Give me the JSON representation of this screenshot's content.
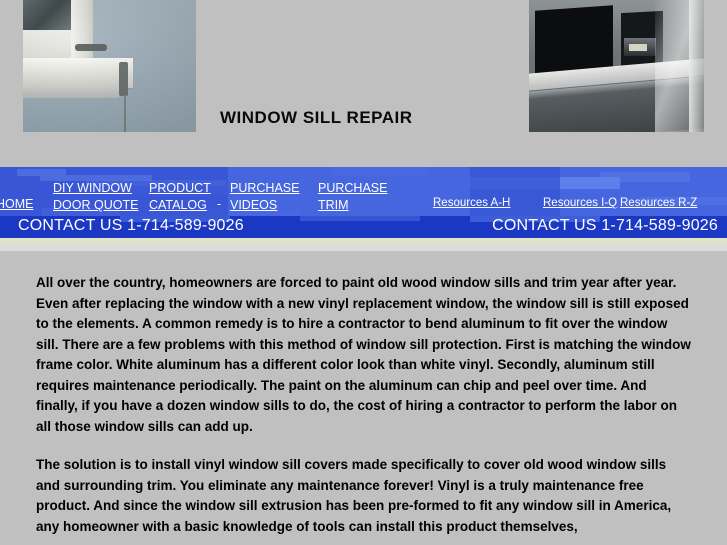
{
  "banner": {
    "title": "WINDOW SILL REPAIR",
    "left_photo_alt": "damaged white wood window sill on blue stucco wall",
    "right_photo_alt": "dark photo of house windows with sills"
  },
  "nav": {
    "items": [
      {
        "id": "home",
        "label": "HOME"
      },
      {
        "id": "diy",
        "label": "DIY WINDOW\nDOOR QUOTE"
      },
      {
        "id": "catalog",
        "label": "PRODUCT\nCATALOG"
      },
      {
        "id": "videos",
        "label": "PURCHASE\nVIDEOS"
      },
      {
        "id": "trim",
        "label": "PURCHASE\nTRIM"
      }
    ],
    "separator": "-",
    "resources": [
      {
        "id": "res-ah",
        "label": "Resources A-H"
      },
      {
        "id": "res-iq",
        "label": "Resources I-Q"
      },
      {
        "id": "res-rz",
        "label": "Resources R-Z"
      }
    ]
  },
  "contact": {
    "left_text": "CONTACT US 1-714-589-9026",
    "right_text": "CONTACT US 1-714-589-9026",
    "phone": "1-714-589-9026"
  },
  "content": {
    "paragraphs": [
      "All over the country, homeowners are forced to paint old wood window sills and trim year after year. Even after replacing the window with a new vinyl replacement window, the window sill is still exposed to the elements. A common remedy is to hire a contractor to bend aluminum to fit over the window sill. There are a few problems with this method of window sill protection. First is matching the window frame color. White aluminum has a different color look than white vinyl. Secondly, aluminum still requires maintenance periodically. The paint on the aluminum can chip and peel over time. And finally, if you have a dozen window sills to do, the cost of hiring a contractor to perform the labor on all those window sills can add up.",
      "The solution is to install vinyl window sill covers made specifically to cover old wood window sills and surrounding trim. You eliminate any maintenance forever! Vinyl is a truly maintenance free product. And since the window sill extrusion has been pre-formed to fit any window sill in America, any homeowner with a basic knowledge of tools can install this product themselves,"
    ]
  },
  "colors": {
    "nav_blue": "#1a38c4",
    "nav_blue_light": "#4868e2",
    "page_gray": "#c0c0c0",
    "cream_strip": "#e4e4c4",
    "link_white": "#ffffff"
  }
}
